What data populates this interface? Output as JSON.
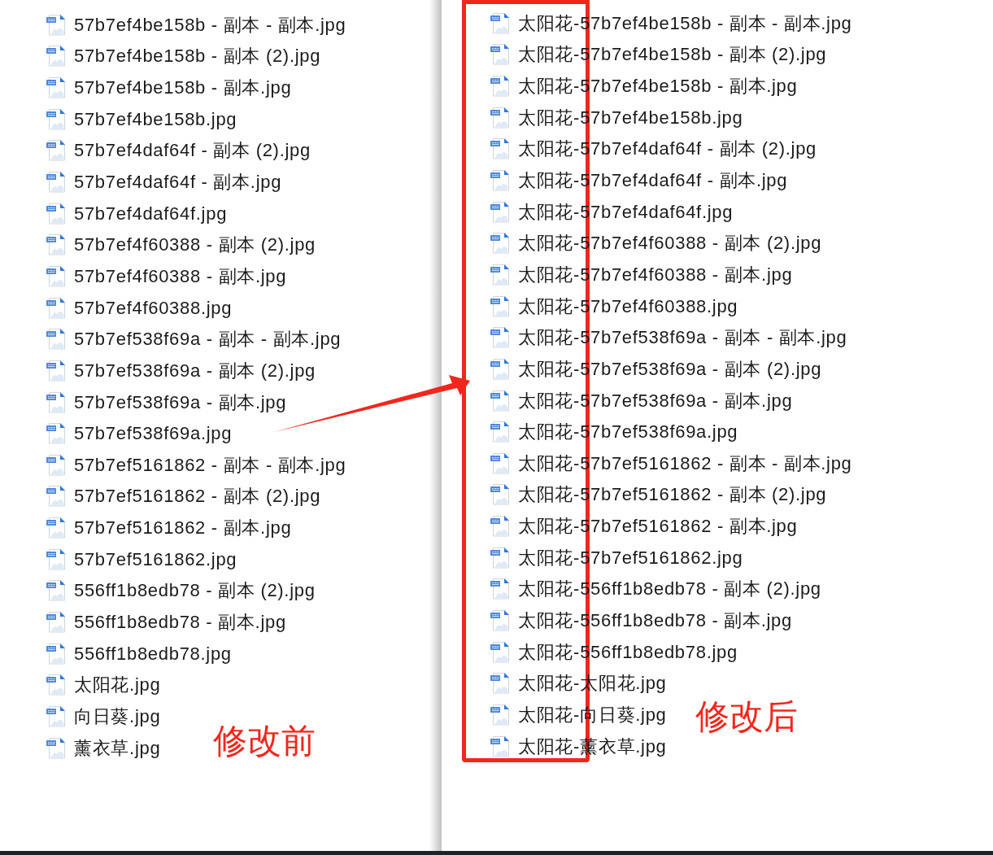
{
  "before_panel": {
    "files": [
      "57b7ef4be158b - 副本 - 副本.jpg",
      "57b7ef4be158b - 副本 (2).jpg",
      "57b7ef4be158b - 副本.jpg",
      "57b7ef4be158b.jpg",
      "57b7ef4daf64f - 副本 (2).jpg",
      "57b7ef4daf64f - 副本.jpg",
      "57b7ef4daf64f.jpg",
      "57b7ef4f60388 - 副本 (2).jpg",
      "57b7ef4f60388 - 副本.jpg",
      "57b7ef4f60388.jpg",
      "57b7ef538f69a - 副本 - 副本.jpg",
      "57b7ef538f69a - 副本 (2).jpg",
      "57b7ef538f69a - 副本.jpg",
      "57b7ef538f69a.jpg",
      "57b7ef5161862 - 副本 - 副本.jpg",
      "57b7ef5161862 - 副本 (2).jpg",
      "57b7ef5161862 - 副本.jpg",
      "57b7ef5161862.jpg",
      "556ff1b8edb78 - 副本 (2).jpg",
      "556ff1b8edb78 - 副本.jpg",
      "556ff1b8edb78.jpg",
      "太阳花.jpg",
      "向日葵.jpg",
      "薰衣草.jpg"
    ],
    "caption": "修改前"
  },
  "after_panel": {
    "files": [
      "太阳花-57b7ef4be158b - 副本 - 副本.jpg",
      "太阳花-57b7ef4be158b - 副本 (2).jpg",
      "太阳花-57b7ef4be158b - 副本.jpg",
      "太阳花-57b7ef4be158b.jpg",
      "太阳花-57b7ef4daf64f - 副本 (2).jpg",
      "太阳花-57b7ef4daf64f - 副本.jpg",
      "太阳花-57b7ef4daf64f.jpg",
      "太阳花-57b7ef4f60388 - 副本 (2).jpg",
      "太阳花-57b7ef4f60388 - 副本.jpg",
      "太阳花-57b7ef4f60388.jpg",
      "太阳花-57b7ef538f69a - 副本 - 副本.jpg",
      "太阳花-57b7ef538f69a - 副本 (2).jpg",
      "太阳花-57b7ef538f69a - 副本.jpg",
      "太阳花-57b7ef538f69a.jpg",
      "太阳花-57b7ef5161862 - 副本 - 副本.jpg",
      "太阳花-57b7ef5161862 - 副本 (2).jpg",
      "太阳花-57b7ef5161862 - 副本.jpg",
      "太阳花-57b7ef5161862.jpg",
      "太阳花-556ff1b8edb78 - 副本 (2).jpg",
      "太阳花-556ff1b8edb78 - 副本.jpg",
      "太阳花-556ff1b8edb78.jpg",
      "太阳花-太阳花.jpg",
      "太阳花-向日葵.jpg",
      "太阳花-薰衣草.jpg"
    ],
    "caption": "修改后"
  }
}
